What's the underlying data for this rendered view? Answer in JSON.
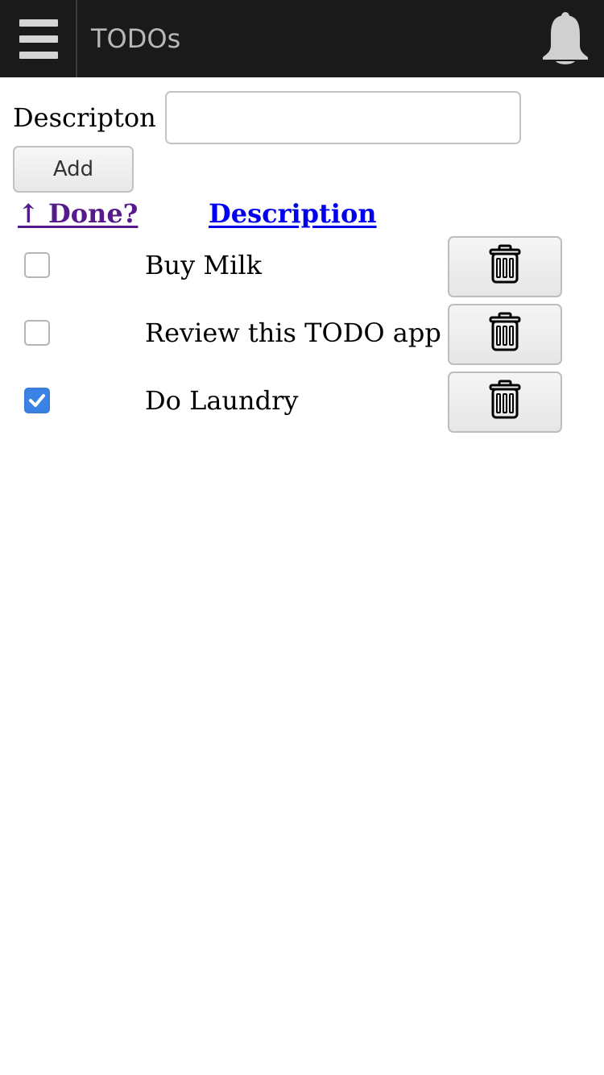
{
  "app_bar": {
    "title": "TODOs",
    "icons": {
      "menu": "hamburger-menu-icon",
      "notifications": "bell-icon"
    },
    "colors": {
      "background": "#1a1a1a",
      "foreground": "#b8b8b8"
    }
  },
  "form": {
    "description_label": "Descripton",
    "description_value": "",
    "add_label": "Add"
  },
  "table": {
    "headers": {
      "done": "↑ Done?",
      "description": "Description"
    },
    "colors": {
      "visited_link": "#551a8b",
      "link": "#0000ee",
      "checkbox_checked": "#3b82e6"
    },
    "rows": [
      {
        "done": false,
        "description": "Buy Milk",
        "delete_icon": "trash-icon"
      },
      {
        "done": false,
        "description": "Review this TODO app",
        "delete_icon": "trash-icon"
      },
      {
        "done": true,
        "description": "Do Laundry",
        "delete_icon": "trash-icon"
      }
    ]
  }
}
